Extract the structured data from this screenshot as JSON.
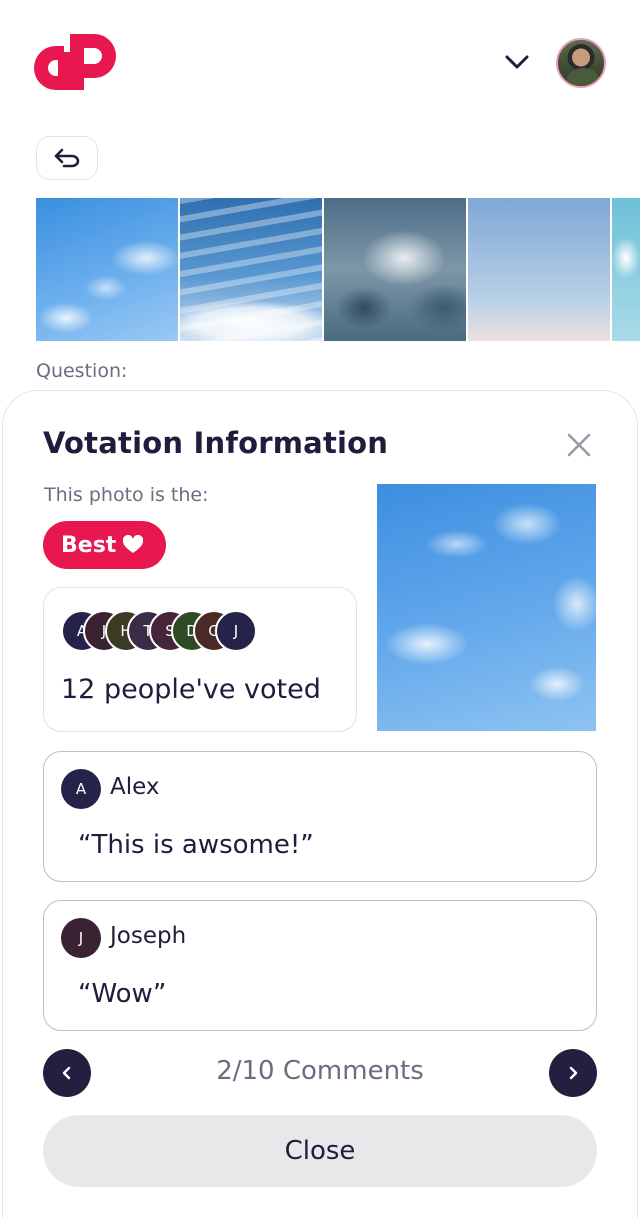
{
  "header": {
    "logo_icon": "dp-logo-icon",
    "brand_color": "#e8174f",
    "dropdown_icon": "chevron-down-icon",
    "avatar_icon": "user-avatar"
  },
  "back_button": {
    "icon": "undo-arrow-icon"
  },
  "gallery": {
    "thumbnails": [
      "sky-photo-1",
      "sky-photo-2",
      "sky-photo-3",
      "sky-photo-4",
      "sky-photo-5"
    ]
  },
  "question_label": "Question:",
  "modal": {
    "title": "Votation Information",
    "close_icon": "close-icon",
    "photo_is_label": "This photo is the:",
    "badge": {
      "label": "Best",
      "icon": "heart-icon",
      "color": "#e8174f"
    },
    "voters": {
      "initials": [
        "A",
        "J",
        "H",
        "T",
        "S",
        "D",
        "G",
        "J"
      ],
      "colors": [
        "#26234a",
        "#3a2233",
        "#3b3a22",
        "#3a2c46",
        "#47243a",
        "#2e4a24",
        "#4a2a24",
        "#26234a"
      ],
      "text": "12 people've voted"
    },
    "comments": [
      {
        "initial": "A",
        "name": "Alex",
        "text": "“This is awsome!”",
        "color": "#26234a"
      },
      {
        "initial": "J",
        "name": "Joseph",
        "text": "“Wow”",
        "color": "#3a2233"
      }
    ],
    "pagination": {
      "text": "2/10 Comments",
      "prev_icon": "chevron-left-icon",
      "next_icon": "chevron-right-icon"
    },
    "close_button_label": "Close"
  }
}
